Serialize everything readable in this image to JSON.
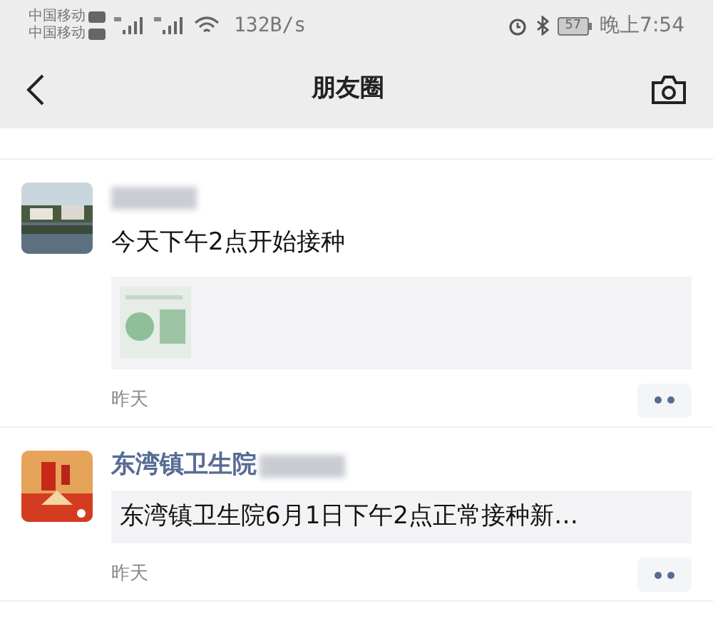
{
  "status_bar": {
    "carrier_1": "中国移动",
    "carrier_2": "中国移动",
    "speed": "132B/s",
    "battery": "57",
    "time": "晚上7:54"
  },
  "nav": {
    "title": "朋友圈"
  },
  "posts": [
    {
      "kind": "text",
      "text": "今天下午2点开始接种",
      "time": "昨天"
    },
    {
      "kind": "link",
      "name": "东湾镇卫生院",
      "link": "东湾镇卫生院6月1日下午2点正常接种新…",
      "time": "昨天"
    }
  ]
}
